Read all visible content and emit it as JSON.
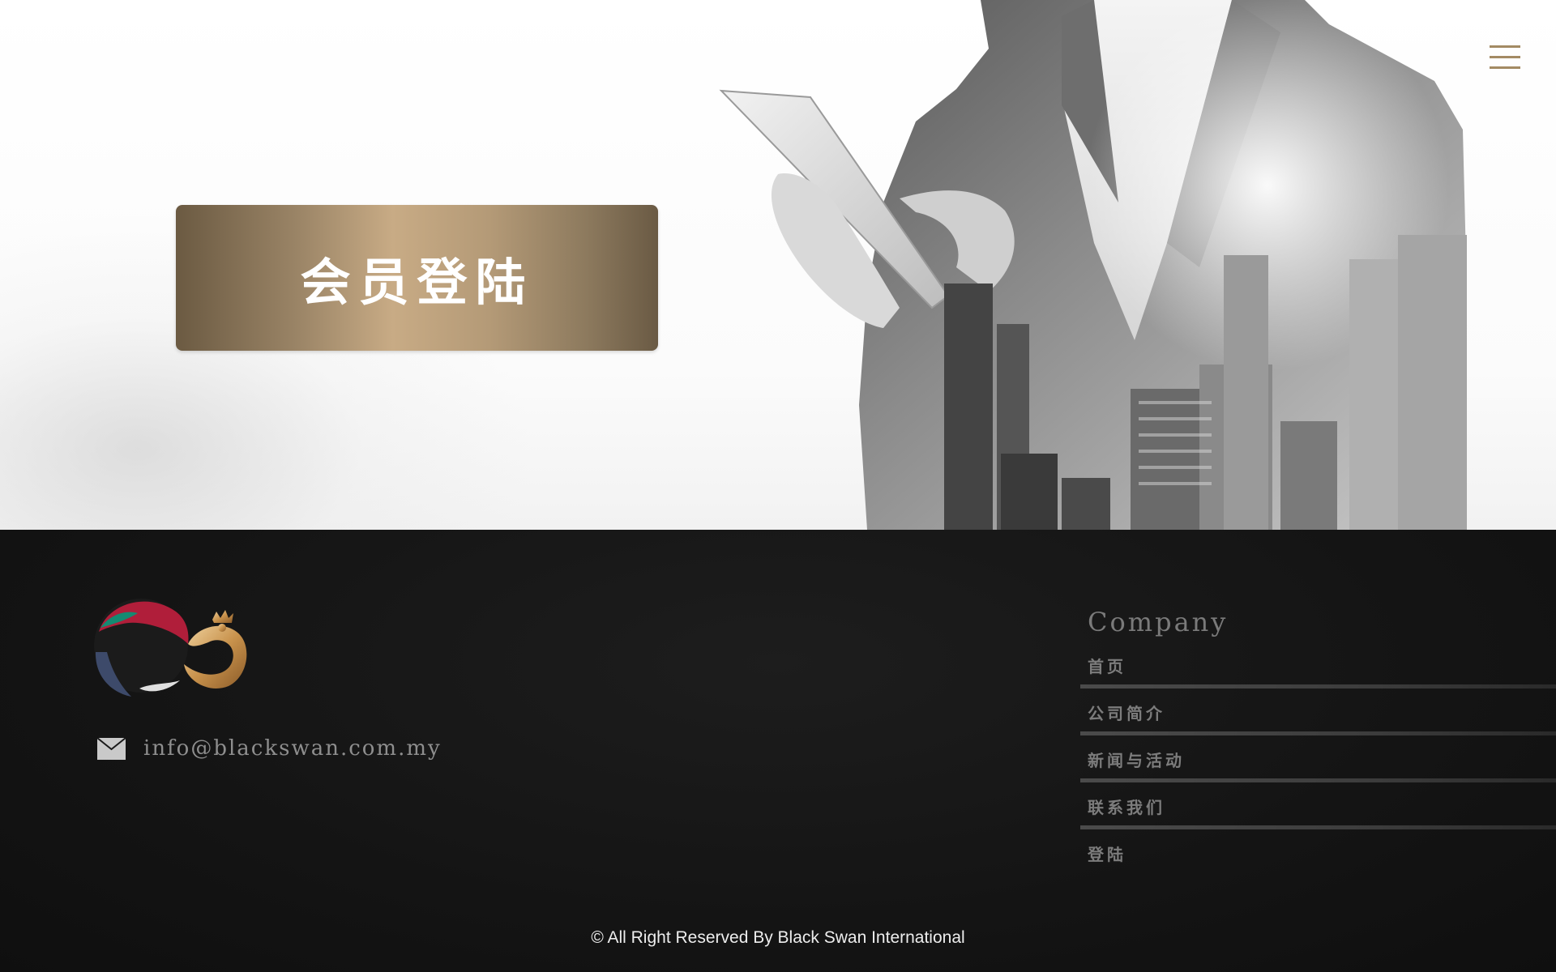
{
  "hero": {
    "login_button_label": "会员登陆",
    "menu_icon": "hamburger-menu-icon",
    "image": "businessman-with-tablet-city-double-exposure"
  },
  "footer": {
    "logo": "black-swan-logo",
    "email_icon": "mail-icon",
    "email": "info@blackswan.com.my",
    "company": {
      "title": "Company",
      "links": [
        "首页",
        "公司简介",
        "新闻与活动",
        "联系我们",
        "登陆"
      ]
    },
    "copyright": "© All Right Reserved By Black Swan International"
  },
  "colors": {
    "gold": "#c8ab85",
    "gold_dark": "#6b5a42",
    "footer_bg": "#141414",
    "menu_icon": "#a38a63"
  }
}
